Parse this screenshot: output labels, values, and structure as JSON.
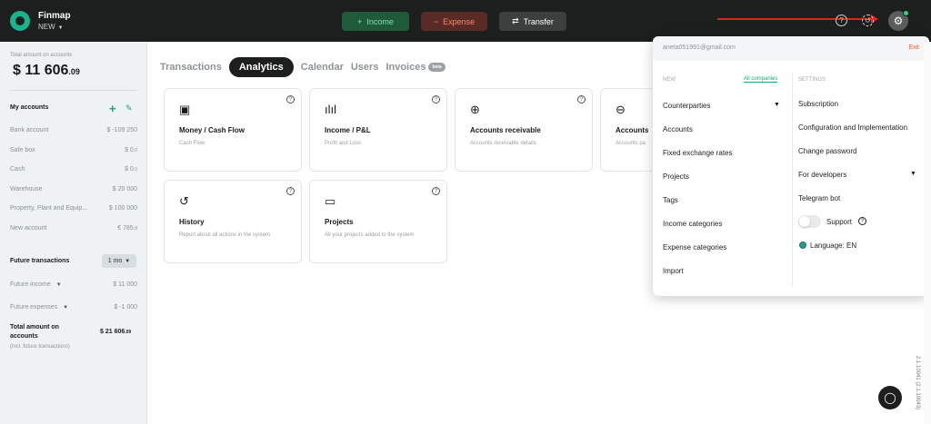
{
  "topbar": {
    "logo_name": "Finmap",
    "logo_sub": "NEW",
    "income_label": "Income",
    "expense_label": "Expense",
    "transfer_label": "Transfer"
  },
  "sidebar": {
    "total_label": "Total amount on accounts",
    "total_main": "$ 11 606",
    "total_cents": ".09",
    "my_accounts": "My accounts",
    "accounts": [
      {
        "name": "Bank account",
        "amount": "$ -109 250",
        "cents": ""
      },
      {
        "name": "Safe box",
        "amount": "$ 0",
        "cents": ".0"
      },
      {
        "name": "Cash",
        "amount": "$ 0",
        "cents": ".0"
      },
      {
        "name": "Warehouse",
        "amount": "$ 20 000",
        "cents": ""
      },
      {
        "name": "Property, Plant and Equip...",
        "amount": "$ 100 000",
        "cents": ""
      },
      {
        "name": "New account",
        "amount": "€ 785",
        "cents": ".8"
      }
    ],
    "future_title": "Future transactions",
    "period": "1 mo",
    "future_income_label": "Future income",
    "future_income_amount": "$ 11 000",
    "future_expenses_label": "Future expenses",
    "future_expenses_amount": "$ -1 000",
    "total_future_label": "Total amount on accounts",
    "total_future_amount": "$ 21 606",
    "total_future_cents": ".09",
    "total_future_note": "(incl. future transactions)"
  },
  "tabs": [
    "Transactions",
    "Analytics",
    "Calendar",
    "Users",
    "Invoices"
  ],
  "beta_label": "beta",
  "cards": [
    {
      "title": "Money / Cash Flow",
      "desc": "Cash Flow",
      "icon": "wallet-icon"
    },
    {
      "title": "Income / P&L",
      "desc": "Profit and Loss",
      "icon": "bar-chart-icon"
    },
    {
      "title": "Accounts receivable",
      "desc": "Accounts receivable details",
      "icon": "arrow-in-icon"
    },
    {
      "title": "Accounts",
      "desc": "Accounts pa",
      "icon": "arrow-out-icon"
    },
    {
      "title": "History",
      "desc": "Report about all actions in the system",
      "icon": "history-icon"
    },
    {
      "title": "Projects",
      "desc": "All your projects added to the system",
      "icon": "folder-icon"
    }
  ],
  "menu": {
    "email": "aneta051991@gmail.com",
    "exit": "Exit",
    "new_title": "NEW",
    "all_companies": "All companies",
    "settings_title": "SETTINGS",
    "left_items": [
      "Counterparties",
      "Accounts",
      "Fixed exchange rates",
      "Projects",
      "Tags",
      "Income categories",
      "Expense categories",
      "Import"
    ],
    "right_items": [
      "Subscription",
      "Configuration and Implementation",
      "Change password",
      "For developers",
      "Telegram bot"
    ],
    "support": "Support",
    "language": "Language: EN"
  },
  "version": "2.1.10041 (2.1.10043)",
  "colors": {
    "accent": "#15a76f",
    "topbar": "#1d1f1e",
    "exit": "#f0623e"
  }
}
